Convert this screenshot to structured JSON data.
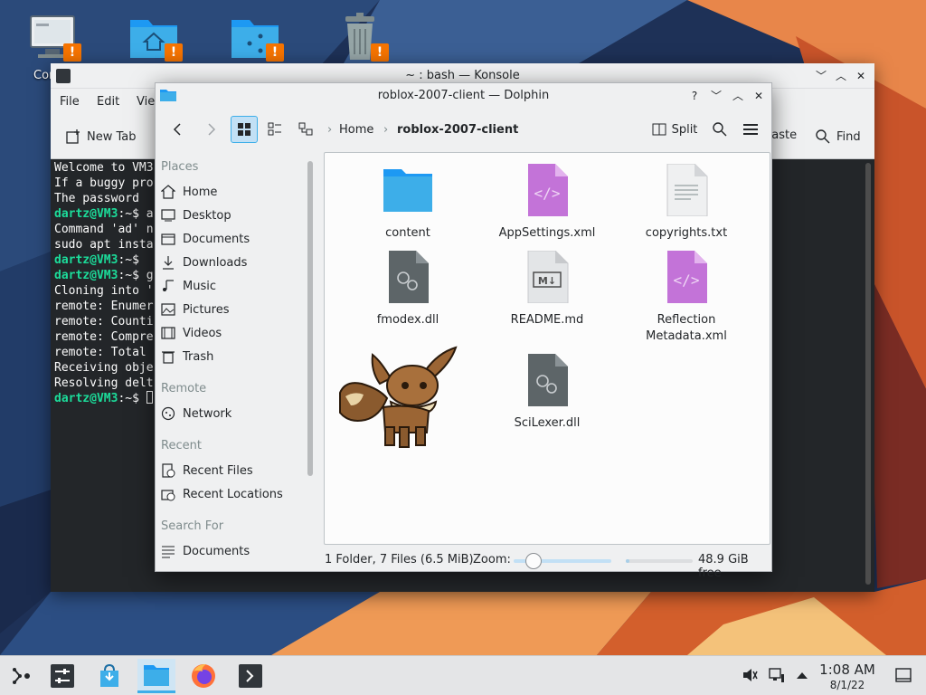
{
  "desktop": {
    "icons": [
      {
        "label": "Comp",
        "icon": "computer-icon"
      },
      {
        "label": "",
        "icon": "home-folder-icon"
      },
      {
        "label": "",
        "icon": "network-folder-icon"
      },
      {
        "label": "",
        "icon": "trash-icon"
      }
    ],
    "warning_glyph": "!"
  },
  "konsole": {
    "title": "~ : bash — Konsole",
    "menu": [
      "File",
      "Edit",
      "Vie"
    ],
    "toolbar": {
      "new_tab": "New Tab",
      "paste": "Paste",
      "find": "Find"
    },
    "lines": [
      {
        "prompt": "",
        "text": "Welcome to VM3"
      },
      {
        "prompt": "",
        "text": "If a buggy pro"
      },
      {
        "prompt": "",
        "text": "The password "
      },
      {
        "prompt": "",
        "text": ""
      },
      {
        "prompt": "dartz@VM3",
        "text": ":~$ a"
      },
      {
        "prompt": "",
        "text": "Command 'ad' n"
      },
      {
        "prompt": "",
        "text": "sudo apt insta"
      },
      {
        "prompt": "dartz@VM3",
        "text": ":~$"
      },
      {
        "prompt": "dartz@VM3",
        "text": ":~$ g"
      },
      {
        "prompt": "",
        "text": "Cloning into '"
      },
      {
        "prompt": "",
        "text": "remote: Enumer"
      },
      {
        "prompt": "",
        "text": "remote: Counti"
      },
      {
        "prompt": "",
        "text": "remote: Compre"
      },
      {
        "prompt": "",
        "text": "remote: Total "
      },
      {
        "prompt": "",
        "text": "Receiving obje"
      },
      {
        "prompt": "",
        "text": "Resolving delt"
      },
      {
        "prompt": "dartz@VM3",
        "text": ":~$ "
      }
    ]
  },
  "dolphin": {
    "title": "roblox-2007-client — Dolphin",
    "breadcrumb": {
      "home": "Home",
      "current": "roblox-2007-client"
    },
    "split_label": "Split",
    "sidebar": {
      "places_header": "Places",
      "places": [
        "Home",
        "Desktop",
        "Documents",
        "Downloads",
        "Music",
        "Pictures",
        "Videos",
        "Trash"
      ],
      "remote_header": "Remote",
      "remote": [
        "Network"
      ],
      "recent_header": "Recent",
      "recent": [
        "Recent Files",
        "Recent Locations"
      ],
      "search_header": "Search For",
      "search": [
        "Documents"
      ]
    },
    "files": [
      {
        "name": "content",
        "kind": "folder"
      },
      {
        "name": "AppSettings.xml",
        "kind": "xml"
      },
      {
        "name": "copyrights.txt",
        "kind": "text"
      },
      {
        "name": "fmodex.dll",
        "kind": "dll"
      },
      {
        "name": "README.md",
        "kind": "markdown"
      },
      {
        "name": "Reflection\nMetadata.xml",
        "kind": "xml"
      },
      {
        "name": "SciLexer.dll",
        "kind": "dll"
      }
    ],
    "status": {
      "summary": "1 Folder, 7 Files (6.5 MiB)",
      "zoom_label": "Zoom:",
      "zoom_level": 0.2,
      "free_fraction": 0.05,
      "free": "48.9 GiB free"
    }
  },
  "taskbar": {
    "items": [
      "launcher-icon",
      "settings-icon",
      "discover-icon",
      "dolphin-icon",
      "firefox-icon",
      "konsole-icon"
    ],
    "clock": {
      "time": "1:08 AM",
      "date": "8/1/22"
    }
  },
  "colors": {
    "accent": "#3daee9",
    "warning": "#f67400",
    "folder": "#3daee9",
    "xml": "#c373d8",
    "terminal_bg": "#232629",
    "prompt": "#1cdc9a"
  }
}
